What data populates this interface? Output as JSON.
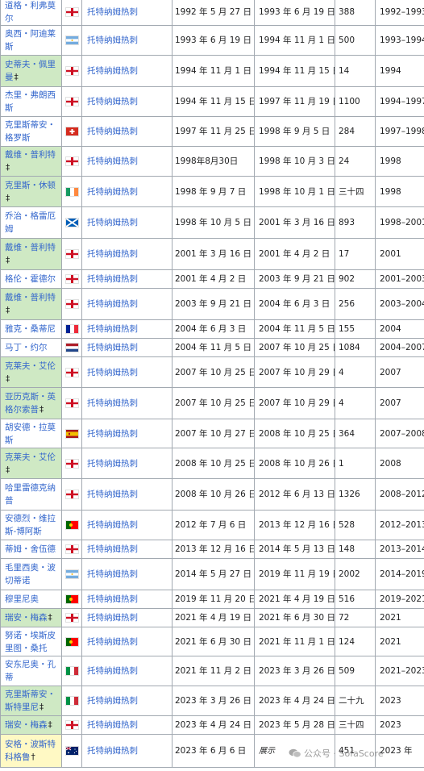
{
  "rows": [
    {
      "name": "道格・利弗莫尔",
      "dagger": "",
      "green": false,
      "flag": "england-flag",
      "club": "托特纳姆热刺",
      "start": "1992 年 5 月 27 日",
      "end": "1993 年 6 月 19 日",
      "days": "388",
      "years": "1992–1993"
    },
    {
      "name": "奥西・阿迪莱斯",
      "dagger": "",
      "green": false,
      "flag": "argentina-flag",
      "club": "托特纳姆热刺",
      "start": "1993 年 6 月 19 日",
      "end": "1994 年 11 月 1 日",
      "days": "500",
      "years": "1993–1994"
    },
    {
      "name": "史蒂夫・佩里曼",
      "dagger": "‡",
      "green": true,
      "flag": "england-flag",
      "club": "托特纳姆热刺",
      "start": "1994 年 11 月 1 日",
      "end": "1994 年 11 月 15 日",
      "days": "14",
      "years": "1994"
    },
    {
      "name": "杰里・弗朗西斯",
      "dagger": "",
      "green": false,
      "flag": "england-flag",
      "club": "托特纳姆热刺",
      "start": "1994 年 11 月 15 日",
      "end": "1997 年 11 月 19 日",
      "days": "1100",
      "years": "1994–1997"
    },
    {
      "name": "克里斯蒂安・格罗斯",
      "dagger": "",
      "green": false,
      "flag": "switzerland-flag",
      "club": "托特纳姆热刺",
      "start": "1997 年 11 月 25 日",
      "end": "1998 年 9 月 5 日",
      "days": "284",
      "years": "1997–1998"
    },
    {
      "name": "戴维・普利特",
      "dagger": "‡",
      "green": true,
      "flag": "england-flag",
      "club": "托特纳姆热刺",
      "start": "1998年8月30日",
      "end": "1998 年 10 月 3 日",
      "days": "24",
      "years": "1998"
    },
    {
      "name": "克里斯・休顿",
      "dagger": "‡",
      "green": true,
      "flag": "ireland-flag",
      "club": "托特纳姆热刺",
      "start": "1998 年 9 月 7 日",
      "end": "1998 年 10 月 1 日",
      "days": "三十四",
      "years": "1998"
    },
    {
      "name": "乔治・格雷厄姆",
      "dagger": "",
      "green": false,
      "flag": "scotland-flag",
      "club": "托特纳姆热刺",
      "start": "1998 年 10 月 5 日",
      "end": "2001 年 3 月 16 日",
      "days": "893",
      "years": "1998–2001"
    },
    {
      "name": "戴维・普利特",
      "dagger": "‡",
      "green": true,
      "flag": "england-flag",
      "club": "托特纳姆热刺",
      "start": "2001 年 3 月 16 日",
      "end": "2001 年 4 月 2 日",
      "days": "17",
      "years": "2001"
    },
    {
      "name": "格伦・霍德尔",
      "dagger": "",
      "green": false,
      "flag": "england-flag",
      "club": "托特纳姆热刺",
      "start": "2001 年 4 月 2 日",
      "end": "2003 年 9 月 21 日",
      "days": "902",
      "years": "2001–2003"
    },
    {
      "name": "戴维・普利特",
      "dagger": "‡",
      "green": true,
      "flag": "england-flag",
      "club": "托特纳姆热刺",
      "start": "2003 年 9 月 21 日",
      "end": "2004 年 6 月 3 日",
      "days": "256",
      "years": "2003–2004"
    },
    {
      "name": "雅克・桑蒂尼",
      "dagger": "",
      "green": false,
      "flag": "france-flag",
      "club": "托特纳姆热刺",
      "start": "2004 年 6 月 3 日",
      "end": "2004 年 11 月 5 日",
      "days": "155",
      "years": "2004"
    },
    {
      "name": "马丁・约尔",
      "dagger": "",
      "green": false,
      "flag": "netherlands-flag",
      "club": "托特纳姆热刺",
      "start": "2004 年 11 月 5 日",
      "end": "2007 年 10 月 25 日",
      "days": "1084",
      "years": "2004–2007"
    },
    {
      "name": "克莱夫・艾伦",
      "dagger": "‡",
      "green": true,
      "flag": "england-flag",
      "club": "托特纳姆热刺",
      "start": "2007 年 10 月 25 日",
      "end": "2007 年 10 月 29 日",
      "days": "4",
      "years": "2007"
    },
    {
      "name": "亚历克斯・英格尔索普",
      "dagger": "‡",
      "green": true,
      "flag": "england-flag",
      "club": "托特纳姆热刺",
      "start": "2007 年 10 月 25 日",
      "end": "2007 年 10 月 29 日",
      "days": "4",
      "years": "2007"
    },
    {
      "name": "胡安德・拉莫斯",
      "dagger": "",
      "green": false,
      "flag": "spain-flag",
      "club": "托特纳姆热刺",
      "start": "2007 年 10 月 27 日",
      "end": "2008 年 10 月 25 日",
      "days": "364",
      "years": "2007–2008"
    },
    {
      "name": "克莱夫・艾伦",
      "dagger": "‡",
      "green": true,
      "flag": "england-flag",
      "club": "托特纳姆热刺",
      "start": "2008 年 10 月 25 日",
      "end": "2008 年 10 月 26 日",
      "days": "1",
      "years": "2008"
    },
    {
      "name": "哈里雷德克纳普",
      "dagger": "",
      "green": false,
      "flag": "england-flag",
      "club": "托特纳姆热刺",
      "start": "2008 年 10 月 26 日",
      "end": "2012 年 6 月 13 日",
      "days": "1326",
      "years": "2008–2012"
    },
    {
      "name": "安德烈・维拉斯-博阿斯",
      "dagger": "",
      "green": false,
      "flag": "portugal-flag",
      "club": "托特纳姆热刺",
      "start": "2012 年 7 月 6 日",
      "end": "2013 年 12 月 16 日",
      "days": "528",
      "years": "2012–2013"
    },
    {
      "name": "蒂姆・舍伍德",
      "dagger": "",
      "green": false,
      "flag": "england-flag",
      "club": "托特纳姆热刺",
      "start": "2013 年 12 月 16 日",
      "end": "2014 年 5 月 13 日",
      "days": "148",
      "years": "2013–2014"
    },
    {
      "name": "毛里西奥・波切蒂诺",
      "dagger": "",
      "green": false,
      "flag": "argentina-flag",
      "club": "托特纳姆热刺",
      "start": "2014 年 5 月 27 日",
      "end": "2019 年 11 月 19 日",
      "days": "2002",
      "years": "2014–2019"
    },
    {
      "name": "穆里尼奥",
      "dagger": "",
      "green": false,
      "flag": "portugal-flag",
      "club": "托特纳姆热刺",
      "start": "2019 年 11 月 20 日",
      "end": "2021 年 4 月 19 日",
      "days": "516",
      "years": "2019–2021"
    },
    {
      "name": "瑞安・梅森",
      "dagger": "‡",
      "green": true,
      "flag": "england-flag",
      "club": "托特纳姆热刺",
      "start": "2021 年 4 月 19 日",
      "end": "2021 年 6 月 30 日",
      "days": "72",
      "years": "2021"
    },
    {
      "name": "努诺・埃斯皮里图・桑托",
      "dagger": "",
      "green": false,
      "flag": "portugal-flag",
      "club": "托特纳姆热刺",
      "start": "2021 年 6 月 30 日",
      "end": "2021 年 11 月 1 日",
      "days": "124",
      "years": "2021"
    },
    {
      "name": "安东尼奥・孔蒂",
      "dagger": "",
      "green": false,
      "flag": "italy-flag",
      "club": "托特纳姆热刺",
      "start": "2021 年 11 月 2 日",
      "end": "2023 年 3 月 26 日",
      "days": "509",
      "years": "2021–2023"
    },
    {
      "name": "克里斯蒂安・斯特里尼",
      "dagger": "‡",
      "green": true,
      "flag": "italy-flag",
      "club": "托特纳姆热刺",
      "start": "2023 年 3 月 26 日",
      "end": "2023 年 4 月 24 日",
      "days": "二十九",
      "years": "2023"
    },
    {
      "name": "瑞安・梅森",
      "dagger": "‡",
      "green": true,
      "flag": "england-flag",
      "club": "托特纳姆热刺",
      "start": "2023 年 4 月 24 日",
      "end": "2023 年 5 月 28 日",
      "days": "三十四",
      "years": "2023"
    },
    {
      "name": "安格・波斯特科格鲁",
      "dagger": "†",
      "green": false,
      "yellow": true,
      "flag": "australia-flag",
      "club": "托特纳姆热刺",
      "start": "2023 年 6 月 6 日",
      "end": "展示",
      "endItalic": true,
      "days": "451",
      "years": "2023 年"
    }
  ],
  "watermark": {
    "icon": "wechat-icon",
    "text": "公众号 · SofaScore"
  },
  "colors": {
    "link": "#3366cc",
    "interim": "#cfe9c4",
    "current": "#fff9c4",
    "border": "#a2a9b1"
  }
}
